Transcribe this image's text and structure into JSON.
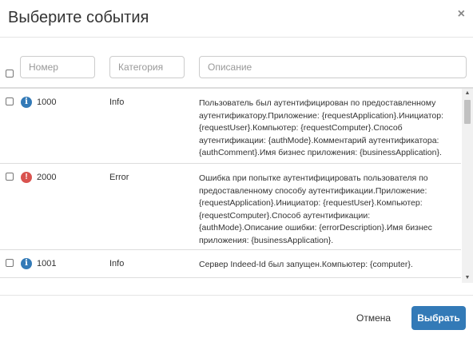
{
  "dialog": {
    "title": "Выберите события",
    "close_label": "×"
  },
  "filters": {
    "number_placeholder": "Номер",
    "category_placeholder": "Категория",
    "description_placeholder": "Описание"
  },
  "rows": [
    {
      "icon": "info-icon",
      "icon_glyph": "i",
      "number": "1000",
      "category": "Info",
      "description": "Пользователь был аутентифицирован по предоставленному аутентификатору.Приложение: {requestApplication}.Инициатор: {requestUser}.Компьютер: {requestComputer}.Способ аутентификации: {authMode}.Комментарий аутентификатора: {authComment}.Имя бизнес приложения: {businessApplication}."
    },
    {
      "icon": "error-icon",
      "icon_glyph": "!",
      "number": "2000",
      "category": "Error",
      "description": "Ошибка при попытке аутентифицировать пользователя по предоставленному способу аутентификации.Приложение: {requestApplication}.Инициатор: {requestUser}.Компьютер: {requestComputer}.Способ аутентификации: {authMode}.Описание ошибки: {errorDescription}.Имя бизнес приложения: {businessApplication}."
    },
    {
      "icon": "info-icon",
      "icon_glyph": "i",
      "number": "1001",
      "category": "Info",
      "description": "Сервер Indeed-Id был запущен.Компьютер: {computer}."
    }
  ],
  "footer": {
    "cancel_label": "Отмена",
    "select_label": "Выбрать"
  },
  "colors": {
    "primary": "#337ab7",
    "error": "#d9534f",
    "info": "#337ab7"
  }
}
